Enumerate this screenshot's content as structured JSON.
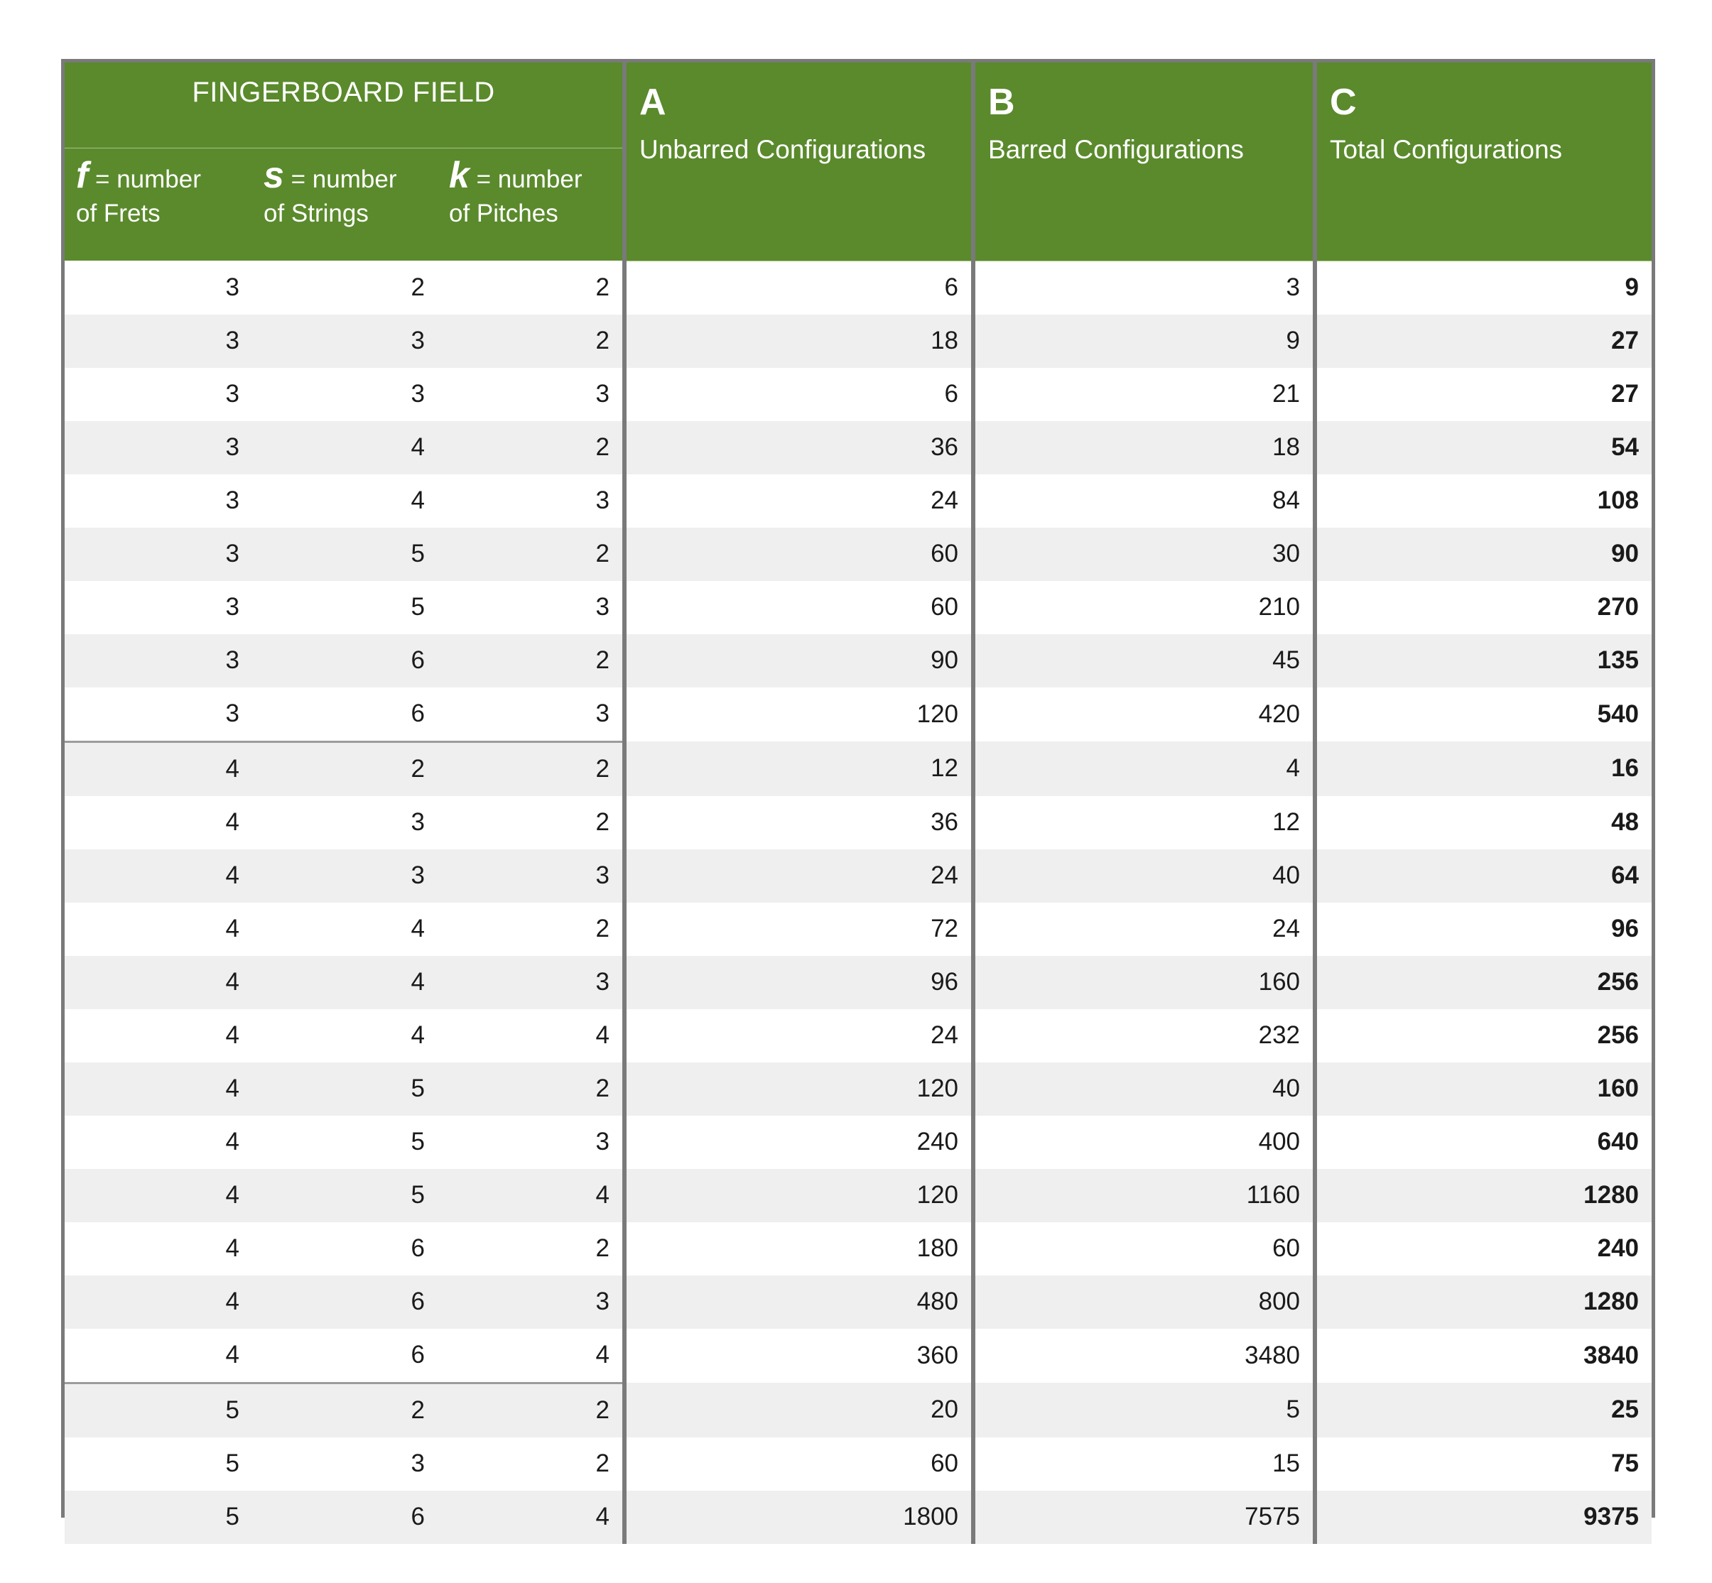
{
  "header": {
    "group_title": "FINGERBOARD FIELD",
    "f": {
      "symbol": "f",
      "line1": " = number",
      "line2": "of Frets"
    },
    "s": {
      "symbol": "s",
      "line1": " = number",
      "line2": "of Strings"
    },
    "k": {
      "symbol": "k",
      "line1": " = number",
      "line2": "of Pitches"
    },
    "a": {
      "letter": "A",
      "label": "Unbarred Configurations"
    },
    "b": {
      "letter": "B",
      "label": "Barred Configurations"
    },
    "c": {
      "letter": "C",
      "label": "Total Configurations"
    }
  },
  "rows": [
    {
      "f": "3",
      "s": "2",
      "k": "2",
      "a": "6",
      "b": "3",
      "c": "9"
    },
    {
      "f": "3",
      "s": "3",
      "k": "2",
      "a": "18",
      "b": "9",
      "c": "27"
    },
    {
      "f": "3",
      "s": "3",
      "k": "3",
      "a": "6",
      "b": "21",
      "c": "27"
    },
    {
      "f": "3",
      "s": "4",
      "k": "2",
      "a": "36",
      "b": "18",
      "c": "54"
    },
    {
      "f": "3",
      "s": "4",
      "k": "3",
      "a": "24",
      "b": "84",
      "c": "108"
    },
    {
      "f": "3",
      "s": "5",
      "k": "2",
      "a": "60",
      "b": "30",
      "c": "90"
    },
    {
      "f": "3",
      "s": "5",
      "k": "3",
      "a": "60",
      "b": "210",
      "c": "270"
    },
    {
      "f": "3",
      "s": "6",
      "k": "2",
      "a": "90",
      "b": "45",
      "c": "135"
    },
    {
      "f": "3",
      "s": "6",
      "k": "3",
      "a": "120",
      "b": "420",
      "c": "540"
    },
    {
      "f": "4",
      "s": "2",
      "k": "2",
      "a": "12",
      "b": "4",
      "c": "16"
    },
    {
      "f": "4",
      "s": "3",
      "k": "2",
      "a": "36",
      "b": "12",
      "c": "48"
    },
    {
      "f": "4",
      "s": "3",
      "k": "3",
      "a": "24",
      "b": "40",
      "c": "64"
    },
    {
      "f": "4",
      "s": "4",
      "k": "2",
      "a": "72",
      "b": "24",
      "c": "96"
    },
    {
      "f": "4",
      "s": "4",
      "k": "3",
      "a": "96",
      "b": "160",
      "c": "256"
    },
    {
      "f": "4",
      "s": "4",
      "k": "4",
      "a": "24",
      "b": "232",
      "c": "256"
    },
    {
      "f": "4",
      "s": "5",
      "k": "2",
      "a": "120",
      "b": "40",
      "c": "160"
    },
    {
      "f": "4",
      "s": "5",
      "k": "3",
      "a": "240",
      "b": "400",
      "c": "640"
    },
    {
      "f": "4",
      "s": "5",
      "k": "4",
      "a": "120",
      "b": "1160",
      "c": "1280"
    },
    {
      "f": "4",
      "s": "6",
      "k": "2",
      "a": "180",
      "b": "60",
      "c": "240"
    },
    {
      "f": "4",
      "s": "6",
      "k": "3",
      "a": "480",
      "b": "800",
      "c": "1280"
    },
    {
      "f": "4",
      "s": "6",
      "k": "4",
      "a": "360",
      "b": "3480",
      "c": "3840"
    },
    {
      "f": "5",
      "s": "2",
      "k": "2",
      "a": "20",
      "b": "5",
      "c": "25"
    },
    {
      "f": "5",
      "s": "3",
      "k": "2",
      "a": "60",
      "b": "15",
      "c": "75"
    },
    {
      "f": "5",
      "s": "6",
      "k": "4",
      "a": "1800",
      "b": "7575",
      "c": "9375"
    }
  ],
  "colors": {
    "header_green": "#5a8a2c",
    "frame_gray": "#7a7a7a",
    "row_alt": "#efefef"
  }
}
